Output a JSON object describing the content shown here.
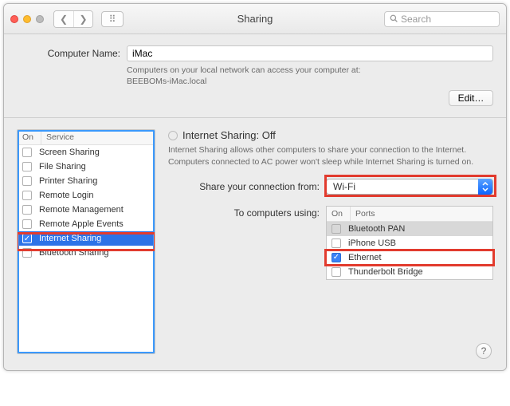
{
  "window": {
    "title": "Sharing",
    "search_placeholder": "Search"
  },
  "computer_name": {
    "label": "Computer Name:",
    "value": "iMac",
    "subtext_line1": "Computers on your local network can access your computer at:",
    "subtext_line2": "BEEBOMs-iMac.local",
    "edit_label": "Edit…"
  },
  "services": {
    "header_on": "On",
    "header_service": "Service",
    "items": [
      {
        "label": "Screen Sharing",
        "checked": false,
        "selected": false
      },
      {
        "label": "File Sharing",
        "checked": false,
        "selected": false
      },
      {
        "label": "Printer Sharing",
        "checked": false,
        "selected": false
      },
      {
        "label": "Remote Login",
        "checked": false,
        "selected": false
      },
      {
        "label": "Remote Management",
        "checked": false,
        "selected": false
      },
      {
        "label": "Remote Apple Events",
        "checked": false,
        "selected": false
      },
      {
        "label": "Internet Sharing",
        "checked": true,
        "selected": true
      },
      {
        "label": "Bluetooth Sharing",
        "checked": false,
        "selected": false
      }
    ]
  },
  "detail": {
    "status_title": "Internet Sharing: Off",
    "description": "Internet Sharing allows other computers to share your connection to the Internet. Computers connected to AC power won't sleep while Internet Sharing is turned on.",
    "share_from_label": "Share your connection from:",
    "share_from_value": "Wi-Fi",
    "to_label": "To computers using:",
    "ports_header_on": "On",
    "ports_header_ports": "Ports",
    "ports": [
      {
        "label": "Bluetooth PAN",
        "checked": false,
        "selected": true
      },
      {
        "label": "iPhone USB",
        "checked": false,
        "selected": false
      },
      {
        "label": "Ethernet",
        "checked": true,
        "selected": false
      },
      {
        "label": "Thunderbolt Bridge",
        "checked": false,
        "selected": false
      }
    ]
  }
}
